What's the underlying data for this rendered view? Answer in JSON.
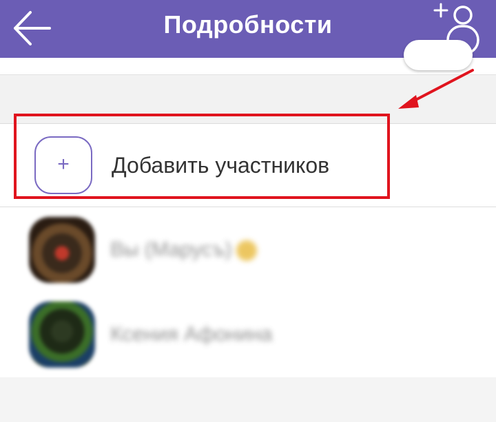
{
  "header": {
    "title": "Подробности",
    "back_icon": "arrow-left-icon",
    "add_contact_icon": "add-person-icon",
    "background": "#6b5db5"
  },
  "add_participants": {
    "label": "Добавить участников",
    "icon": "plus-icon",
    "accent": "#7a6ac2"
  },
  "annotation": {
    "highlight_color": "#e0141e"
  },
  "members": [
    {
      "name": "Вы (Марусъ)",
      "blurred": true
    },
    {
      "name": "Ксения Афонина",
      "blurred": true
    }
  ]
}
